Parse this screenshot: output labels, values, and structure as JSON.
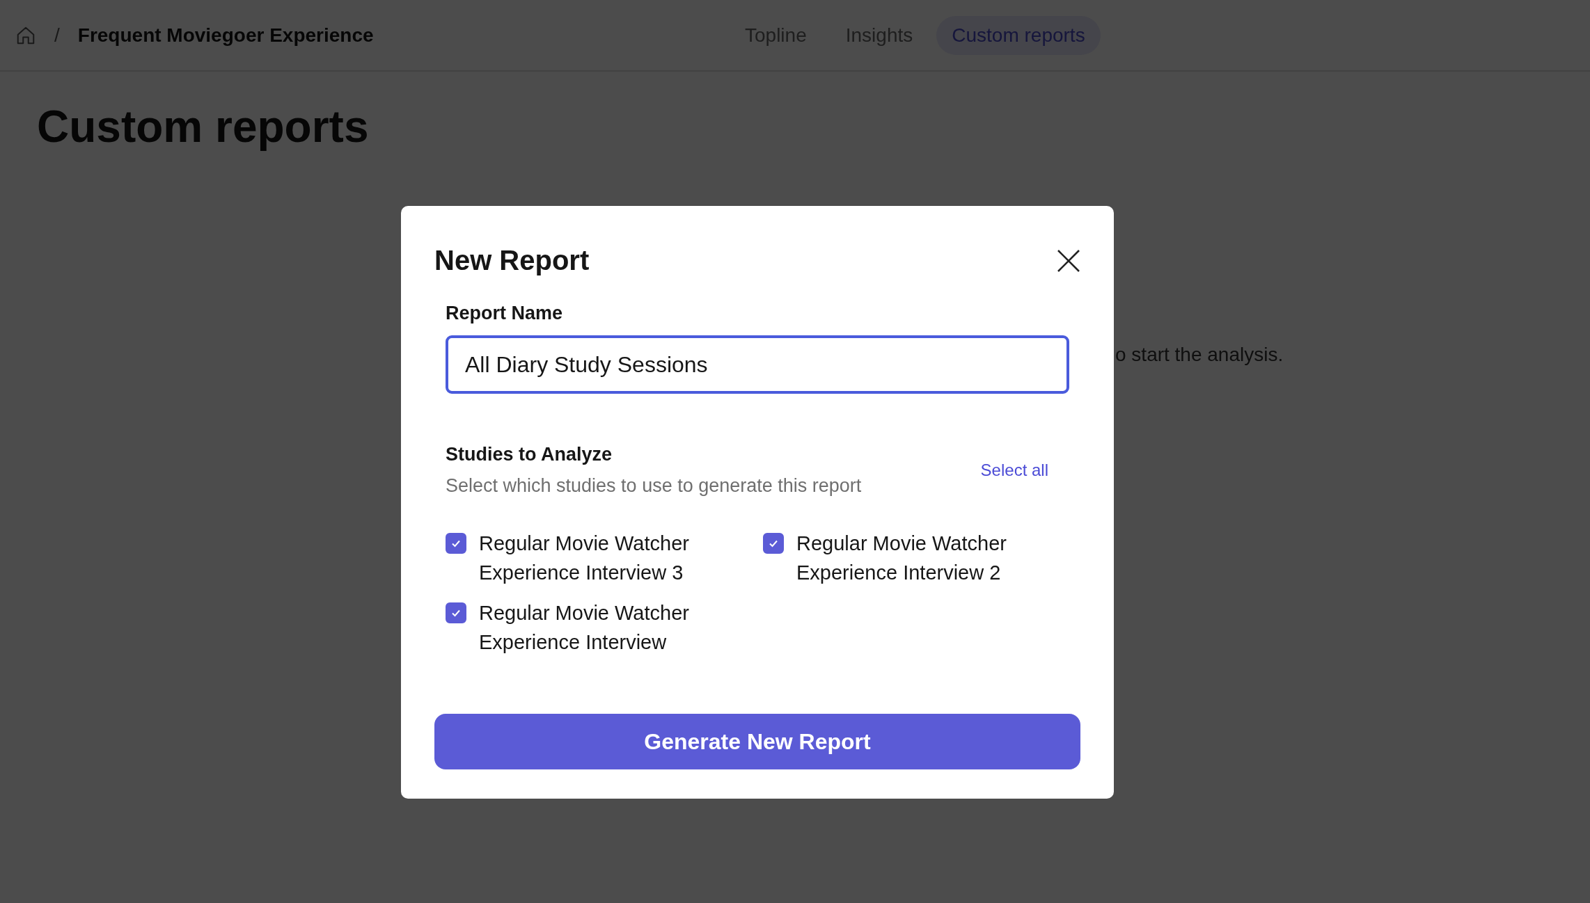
{
  "breadcrumb": {
    "separator": "/",
    "title": "Frequent Moviegoer Experience"
  },
  "tabs": [
    {
      "label": "Topline",
      "selected": false
    },
    {
      "label": "Insights",
      "selected": false
    },
    {
      "label": "Custom reports",
      "selected": true
    }
  ],
  "page": {
    "title": "Custom reports",
    "empty_text": "o start the analysis."
  },
  "modal": {
    "title": "New Report",
    "name_label": "Report Name",
    "name_value": "All Diary Study Sessions",
    "studies_label": "Studies to Analyze",
    "studies_hint": "Select which studies to use to generate this report",
    "select_all": "Select all",
    "studies": [
      {
        "label": "Regular Movie Watcher Experience Interview 3",
        "checked": true
      },
      {
        "label": "Regular Movie Watcher Experience Interview 2",
        "checked": true
      },
      {
        "label": "Regular Movie Watcher Experience Interview",
        "checked": true
      }
    ],
    "submit": "Generate New Report"
  }
}
